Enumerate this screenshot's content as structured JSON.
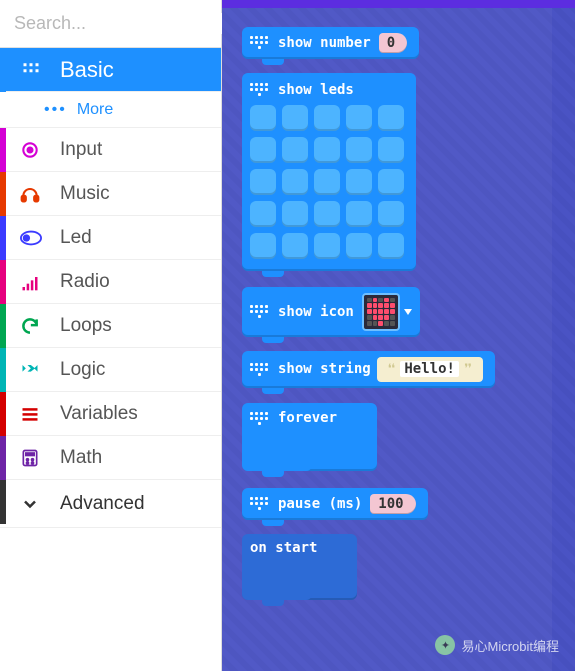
{
  "search": {
    "placeholder": "Search..."
  },
  "categories": [
    {
      "id": "basic",
      "label": "Basic",
      "color": "#1e90ff",
      "active": true,
      "iconColor": "#ffffff"
    },
    {
      "id": "more",
      "label": "More",
      "sub": true
    },
    {
      "id": "input",
      "label": "Input",
      "color": "#d400d4",
      "iconColor": "#d400d4"
    },
    {
      "id": "music",
      "label": "Music",
      "color": "#e63900",
      "iconColor": "#e63900"
    },
    {
      "id": "led",
      "label": "Led",
      "color": "#3b3bff",
      "iconColor": "#3b3bff"
    },
    {
      "id": "radio",
      "label": "Radio",
      "color": "#e6007e",
      "iconColor": "#e6007e"
    },
    {
      "id": "loops",
      "label": "Loops",
      "color": "#00a651",
      "iconColor": "#00a651"
    },
    {
      "id": "logic",
      "label": "Logic",
      "color": "#00b5b5",
      "iconColor": "#00b5b5"
    },
    {
      "id": "variables",
      "label": "Variables",
      "color": "#d40000",
      "iconColor": "#d40000"
    },
    {
      "id": "math",
      "label": "Math",
      "color": "#6e24a6",
      "iconColor": "#6e24a6"
    },
    {
      "id": "advanced",
      "label": "Advanced",
      "color": "#333333",
      "advanced": true
    }
  ],
  "blocks": {
    "show_number": {
      "label": "show number",
      "value": "0"
    },
    "show_leds": {
      "label": "show leds"
    },
    "show_icon": {
      "label": "show icon"
    },
    "show_string": {
      "label": "show string",
      "value": "Hello!"
    },
    "forever": {
      "label": "forever"
    },
    "pause": {
      "label": "pause (ms)",
      "value": "100"
    },
    "on_start": {
      "label": "on start"
    }
  },
  "watermark": "易心Microbit编程"
}
